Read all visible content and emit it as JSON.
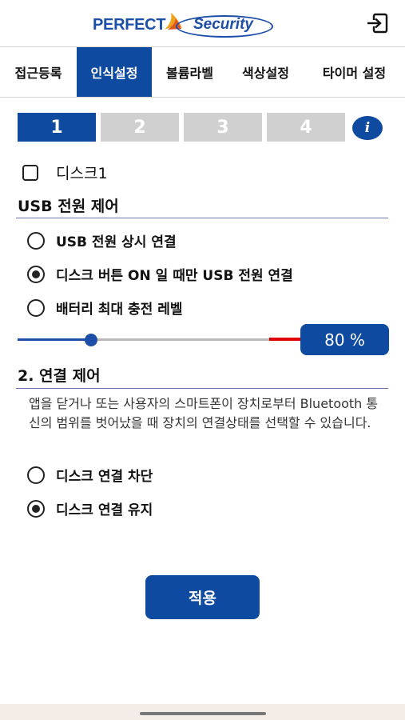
{
  "header": {
    "logo_left": "PERFECT",
    "logo_right": "Security",
    "logout_icon": "logout-icon"
  },
  "tabs": [
    {
      "label": "접근등록",
      "active": false
    },
    {
      "label": "인식설정",
      "active": true
    },
    {
      "label": "볼륨라벨",
      "active": false
    },
    {
      "label": "색상설정",
      "active": false
    },
    {
      "label": "타이머 설정",
      "active": false
    }
  ],
  "steps": [
    {
      "label": "1",
      "active": true
    },
    {
      "label": "2",
      "active": false
    },
    {
      "label": "3",
      "active": false
    },
    {
      "label": "4",
      "active": false
    }
  ],
  "info_label": "i",
  "disk_checkbox": {
    "label": "디스크1",
    "checked": false
  },
  "usb_section": {
    "title": "USB 전원 제어",
    "options": [
      {
        "label": "USB 전원 상시 연결",
        "checked": false
      },
      {
        "label": "디스크 버튼 ON 일 때만 USB 전원 연결",
        "checked": true
      },
      {
        "label": "배터리 최대 충전 레벨",
        "checked": false
      }
    ],
    "battery_level_percent": 80,
    "slider_position": 0.26,
    "battery_level_display": "80 %"
  },
  "connection_section": {
    "title": "2. 연결 제어",
    "description": "앱을 닫거나 또는 사용자의 스마트폰이 장치로부터 Bluetooth 통신의 범위를 벗어났을 때 장치의 연결상태를 선택할 수 있습니다.",
    "options": [
      {
        "label": "디스크 연결 차단",
        "checked": false
      },
      {
        "label": "디스크 연결 유지",
        "checked": true
      }
    ]
  },
  "apply_label": "적용",
  "colors": {
    "primary": "#0e4aa0",
    "step_inactive": "#d0d0d0",
    "slider_red": "#e00000"
  }
}
